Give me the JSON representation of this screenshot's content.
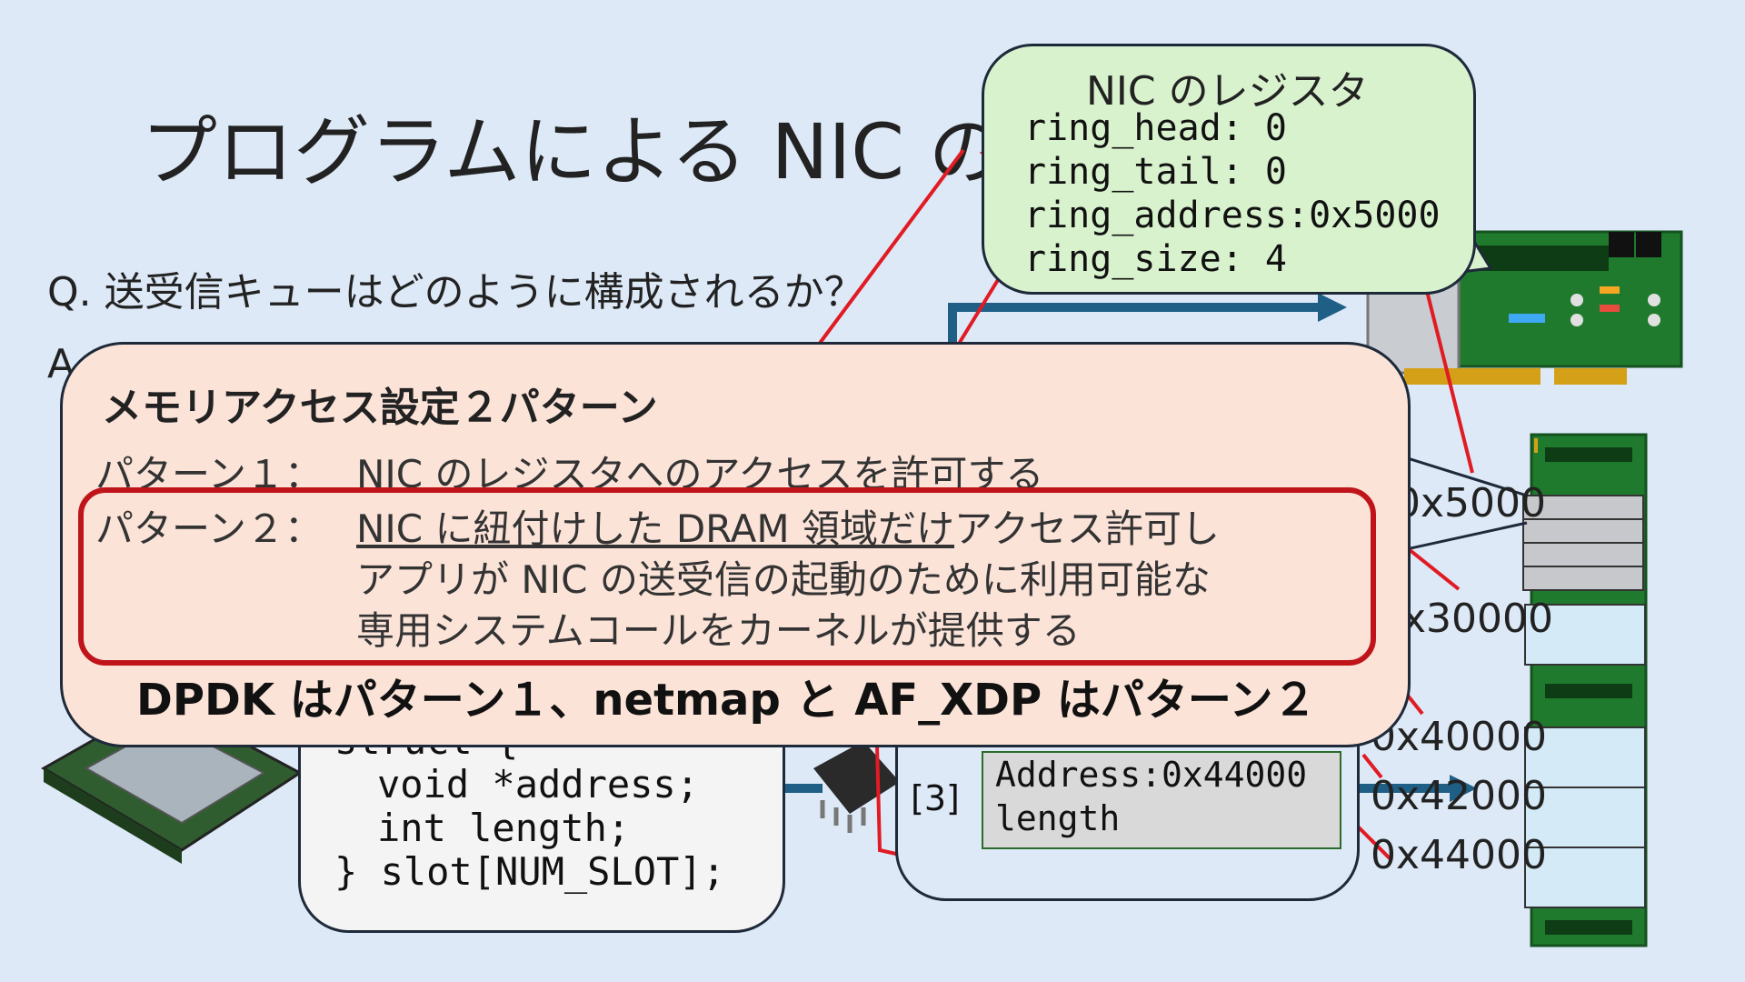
{
  "slide": {
    "title": "プログラムによる NIC の",
    "question": "Q. 送受信キューはどのように構成されるか？",
    "answer_prefix": "A"
  },
  "struct_code": {
    "lines": [
      "struct {",
      "void *address;",
      "int   length;",
      "} slot[NUM_SLOT];"
    ]
  },
  "ring": {
    "slot3_index": "[3]",
    "slot3_address": "Address:0x44000",
    "slot3_length": "length"
  },
  "memory_addresses": [
    "0x5000",
    "0x30000",
    "0x40000",
    "0x42000",
    "0x44000"
  ],
  "nic_registers": {
    "title": "NIC のレジスタ",
    "ring_head": "ring_head: 0",
    "ring_tail": "ring_tail: 0",
    "ring_address": "ring_address:0x5000",
    "ring_size": "ring_size: 4"
  },
  "popup": {
    "title": "メモリアクセス設定２パターン",
    "pattern1_label": "パターン１：",
    "pattern1_text": "NIC のレジスタへのアクセスを許可する",
    "pattern2_label": "パターン２：",
    "pattern2_line1_ul": "NIC に紐付けした DRAM 領域だけ",
    "pattern2_line1_rest": "アクセス許可し",
    "pattern2_line2": "アプリが NIC の送受信の起動のために利用可能な",
    "pattern2_line3": "専用システムコールをカーネルが提供する",
    "summary": "DPDK はパターン１、netmap と AF_XDP はパターン２"
  },
  "colors": {
    "background": "#dde9f7",
    "popup_fill": "#fbe3d8",
    "highlight_red": "#c0141b",
    "nic_bubble_fill": "#d9f2ce",
    "arrow_blue": "#1f5f86",
    "pcb_green": "#1f7a2e"
  },
  "icons": [
    "cpu-chip-icon",
    "nic-card-icon",
    "dram-module-icon",
    "network-chip-icon"
  ]
}
